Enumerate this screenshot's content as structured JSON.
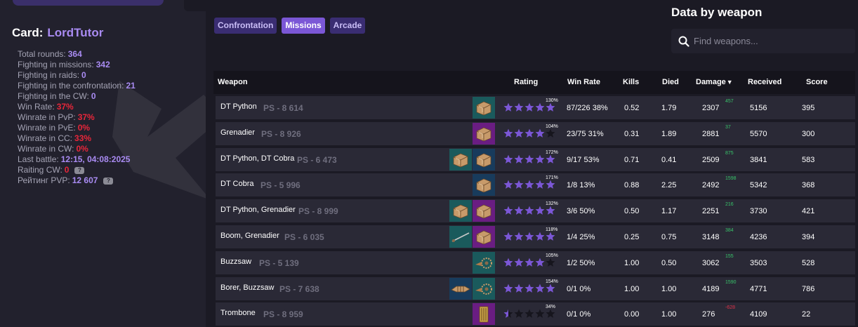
{
  "profile": {
    "card_label": "Card:",
    "card_name": "LordTutor",
    "stats": [
      {
        "label": "Total rounds:",
        "value": "364",
        "color": "blue"
      },
      {
        "label": "Fighting in missions:",
        "value": "342",
        "color": "blue"
      },
      {
        "label": "Fighting in raids:",
        "value": "0",
        "color": "blue"
      },
      {
        "label": "Fighting in the confrontation:",
        "value": "21",
        "color": "blue"
      },
      {
        "label": "Fighting in the CW:",
        "value": "0",
        "color": "blue"
      },
      {
        "label": "Win Rate:",
        "value": "37%",
        "color": "red"
      },
      {
        "label": "Winrate in PvP:",
        "value": "37%",
        "color": "red"
      },
      {
        "label": "Winrate in PvE:",
        "value": "0%",
        "color": "red"
      },
      {
        "label": "Winrate in CC:",
        "value": "33%",
        "color": "red"
      },
      {
        "label": "Winrate in CW:",
        "value": "0%",
        "color": "red"
      },
      {
        "label": "Last battle:",
        "value": "12:15, 04:08:2025",
        "color": "blue"
      },
      {
        "label": "Raiting CW:",
        "value": "0",
        "color": "red",
        "badge": true
      },
      {
        "label": "Рейтинг PVP:",
        "value": "12 607",
        "color": "blue",
        "badge": true
      }
    ]
  },
  "tabs": [
    {
      "label": "Confrontation",
      "active": false
    },
    {
      "label": "Missions",
      "active": true
    },
    {
      "label": "Arcade",
      "active": false
    }
  ],
  "search": {
    "title": "Data by weapon",
    "placeholder": "Find weapons..."
  },
  "table": {
    "headers": {
      "weapon": "Weapon",
      "rating": "Rating",
      "winrate": "Win Rate",
      "kills": "Kills",
      "died": "Died",
      "damage": "Damage",
      "received": "Received",
      "score": "Score"
    },
    "rows": [
      {
        "weapon": "DT Python",
        "ps": "PS - 8 614",
        "icons": [
          {
            "type": "crate",
            "bg": "teal"
          }
        ],
        "stars": 5,
        "rating_pct": "130%",
        "winrate": "87/226 38%",
        "kills": "0.52",
        "died": "1.79",
        "damage": "2307",
        "delta": "457",
        "delta_sign": "pos",
        "received": "5156",
        "score": "395"
      },
      {
        "weapon": "Grenadier",
        "ps": "PS - 8 926",
        "icons": [
          {
            "type": "crate",
            "bg": "purple"
          }
        ],
        "stars": 4,
        "rating_pct": "104%",
        "winrate": "23/75 31%",
        "kills": "0.31",
        "died": "1.89",
        "damage": "2881",
        "delta": "37",
        "delta_sign": "pos",
        "received": "5570",
        "score": "300"
      },
      {
        "weapon": "DT Python, DT Cobra",
        "ps": "PS - 6 473",
        "icons": [
          {
            "type": "crate",
            "bg": "teal"
          },
          {
            "type": "crate",
            "bg": "navy"
          }
        ],
        "stars": 5,
        "rating_pct": "172%",
        "winrate": "9/17 53%",
        "kills": "0.71",
        "died": "0.41",
        "damage": "2509",
        "delta": "875",
        "delta_sign": "pos",
        "received": "3841",
        "score": "583"
      },
      {
        "weapon": "DT Cobra",
        "ps": "PS - 5 996",
        "icons": [
          {
            "type": "crate",
            "bg": "navy"
          }
        ],
        "stars": 5,
        "rating_pct": "171%",
        "winrate": "1/8 13%",
        "kills": "0.88",
        "died": "2.25",
        "damage": "2492",
        "delta": "1598",
        "delta_sign": "pos",
        "received": "5342",
        "score": "368"
      },
      {
        "weapon": "DT Python, Grenadier",
        "ps": "PS - 8 999",
        "icons": [
          {
            "type": "crate",
            "bg": "teal"
          },
          {
            "type": "crate",
            "bg": "purple"
          }
        ],
        "stars": 5,
        "rating_pct": "132%",
        "winrate": "3/6 50%",
        "kills": "0.50",
        "died": "1.17",
        "damage": "2251",
        "delta": "216",
        "delta_sign": "pos",
        "received": "3730",
        "score": "421"
      },
      {
        "weapon": "Boom, Grenadier",
        "ps": "PS - 6 035",
        "icons": [
          {
            "type": "rod",
            "bg": "teal"
          },
          {
            "type": "crate",
            "bg": "purple"
          }
        ],
        "stars": 5,
        "rating_pct": "118%",
        "winrate": "1/4 25%",
        "kills": "0.25",
        "died": "0.75",
        "damage": "3148",
        "delta": "384",
        "delta_sign": "pos",
        "received": "4236",
        "score": "394"
      },
      {
        "weapon": "Buzzsaw",
        "ps": "PS - 5 139",
        "icons": [
          {
            "type": "saw",
            "bg": "teal"
          }
        ],
        "stars": 4,
        "rating_pct": "105%",
        "winrate": "1/2 50%",
        "kills": "1.00",
        "died": "0.50",
        "damage": "3062",
        "delta": "155",
        "delta_sign": "pos",
        "received": "3503",
        "score": "528"
      },
      {
        "weapon": "Borer, Buzzsaw",
        "ps": "PS - 7 638",
        "icons": [
          {
            "type": "drill",
            "bg": "navy"
          },
          {
            "type": "saw",
            "bg": "teal"
          }
        ],
        "stars": 5,
        "rating_pct": "154%",
        "winrate": "0/1 0%",
        "kills": "1.00",
        "died": "1.00",
        "damage": "4189",
        "delta": "1590",
        "delta_sign": "pos",
        "received": "4771",
        "score": "786"
      },
      {
        "weapon": "Trombone",
        "ps": "PS - 8 959",
        "icons": [
          {
            "type": "trombone",
            "bg": "purple"
          }
        ],
        "stars": 0.5,
        "rating_pct": "34%",
        "winrate": "0/1 0%",
        "kills": "0.00",
        "died": "1.00",
        "damage": "276",
        "delta": "-628",
        "delta_sign": "neg",
        "received": "4109",
        "score": "22"
      }
    ]
  },
  "colors": {
    "accent": "#a98bf2",
    "tab_active": "#7b57d6",
    "tab": "#3a2d72",
    "danger": "#e8263a",
    "positive": "#38c46a",
    "star_fill": "#7b57d6",
    "star_empty": "#16151d"
  }
}
